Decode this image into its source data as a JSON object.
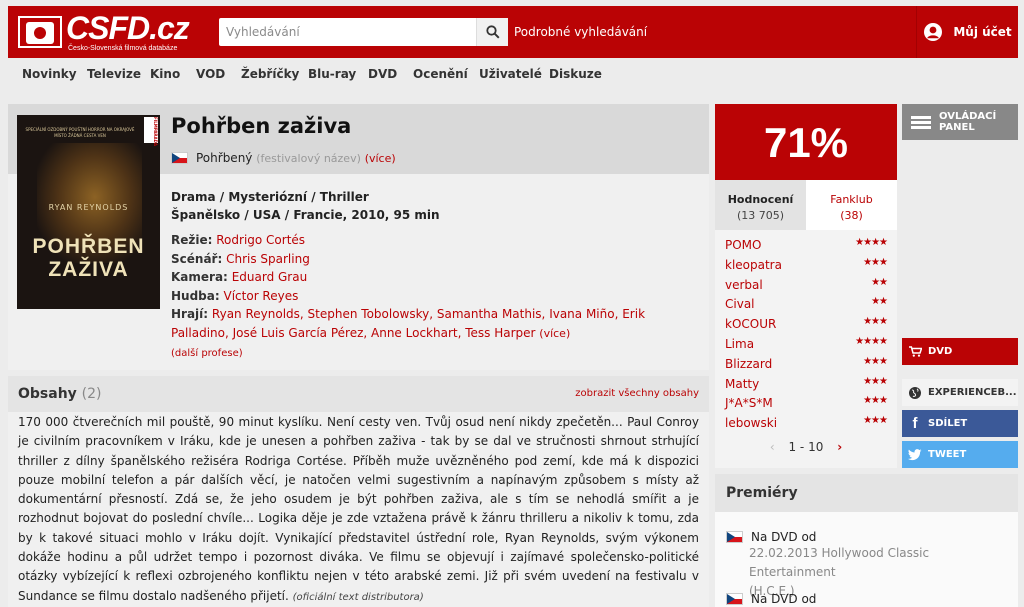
{
  "header": {
    "logo_text": "CSFD.cz",
    "logo_subtitle": "Česko-Slovenská filmová databáze",
    "search_placeholder": "Vyhledávání",
    "advanced_search": "Podrobné vyhledávání",
    "account": "Můj účet"
  },
  "nav": [
    "Novinky",
    "Televize",
    "Kino",
    "VOD",
    "Žebříčky",
    "Blu-ray",
    "DVD",
    "Ocenění",
    "Uživatelé",
    "Diskuze"
  ],
  "film": {
    "title": "Pohřben zaživa",
    "alt_title": "Pohřbený",
    "alt_note": "(festivalový název)",
    "more": "(více)",
    "genres": "Drama / Mysteriózní / Thriller",
    "origin": "Španělsko / USA / Francie, 2010, 95 min",
    "director_label": "Režie:",
    "director": "Rodrigo Cortés",
    "writer_label": "Scénář:",
    "writer": "Chris Sparling",
    "camera_label": "Kamera:",
    "camera": "Eduard Grau",
    "music_label": "Hudba:",
    "music": "Víctor Reyes",
    "cast_label": "Hrají:",
    "cast": "Ryan Reynolds, Stephen Tobolowsky, Samantha Mathis, Ivana Miño, Erik Palladino, José Luis García Pérez, Anne Lockhart, Tess Harper",
    "cast_more": "(více)",
    "other_professions": "(další profese)",
    "poster": {
      "actor": "RYAN REYNOLDS",
      "title_line1": "POHŘBEN",
      "title_line2": "ZAŽIVA",
      "tag": "FILMPARADA",
      "tagline": "SPECIÁLNÍ OZDOBNÝ POUŠTNÍ HORROR NA OKRAJOVÉ MÍSTO ŽÁDNÁ CESTA VEN"
    }
  },
  "plot": {
    "heading": "Obsahy",
    "count": "(2)",
    "show_all": "zobrazit všechny obsahy",
    "text": "170 000 čtverečních mil pouště, 90 minut kyslíku. Není cesty ven. Tvůj osud není nikdy zpečetěn... Paul Conroy je civilním pracovníkem v Iráku, kde je unesen a pohřben zaživa - tak by se dal ve stručnosti shrnout strhující thriller z dílny španělského režiséra Rodriga Cortése. Příběh muže uvězněného pod zemí, kde má k dispozici pouze mobilní telefon a pár dalších věcí, je natočen velmi sugestivním a napínavým způsobem s místy až dokumentární přesností. Zdá se, že jeho osudem je být pohřben zaživa, ale s tím se nehodlá smířit a je rozhodnut bojovat do poslední chvíle... Logika děje je zde vztažena právě k žánru thrilleru a nikoliv k tomu, zda by k takové situaci mohlo v Iráku dojít. Vynikající představitel ústřední role, Ryan Reynolds, svým výkonem dokáže hodinu a půl udržet tempo i pozornost diváka. Ve filmu se objevují i zajímavé společensko-politické otázky vybízející k reflexi ozbrojeného konfliktu nejen v této arabské zemi. Již při svém uvedení na festivalu v Sundance se filmu dostalo nadšeného přijetí.",
    "source": "(oficiální text distributora)"
  },
  "rating": {
    "score": "71%",
    "tab_ratings": "Hodnocení",
    "tab_ratings_count": "(13 705)",
    "tab_fanclub": "Fanklub",
    "tab_fanclub_count": "(38)",
    "users": [
      {
        "name": "POMO",
        "stars": "★★★★"
      },
      {
        "name": "kleopatra",
        "stars": "★★★"
      },
      {
        "name": "verbal",
        "stars": "★★"
      },
      {
        "name": "Cival",
        "stars": "★★"
      },
      {
        "name": "kOCOUR",
        "stars": "★★★"
      },
      {
        "name": "Lima",
        "stars": "★★★★"
      },
      {
        "name": "Blizzard",
        "stars": "★★★"
      },
      {
        "name": "Matty",
        "stars": "★★★"
      },
      {
        "name": "J*A*S*M",
        "stars": "★★★"
      },
      {
        "name": "lebowski",
        "stars": "★★★"
      }
    ],
    "pager": "1 - 10"
  },
  "sidebar": {
    "control_panel_line1": "OVLÁDACÍ",
    "control_panel_line2": "PANEL",
    "dvd": "DVD",
    "experience": "EXPERIENCEB...",
    "share": "SDÍLET",
    "tweet": "TWEET"
  },
  "premieres": {
    "heading": "Premiéry",
    "items": [
      {
        "label": "Na DVD od",
        "detail_line1": "22.02.2013 Hollywood Classic Entertainment",
        "detail_line2": "(H.C.E.)"
      },
      {
        "label": "Na DVD od"
      }
    ]
  },
  "colors": {
    "brand_red": "#ba0305",
    "facebook": "#3b5998",
    "twitter": "#55acee"
  }
}
